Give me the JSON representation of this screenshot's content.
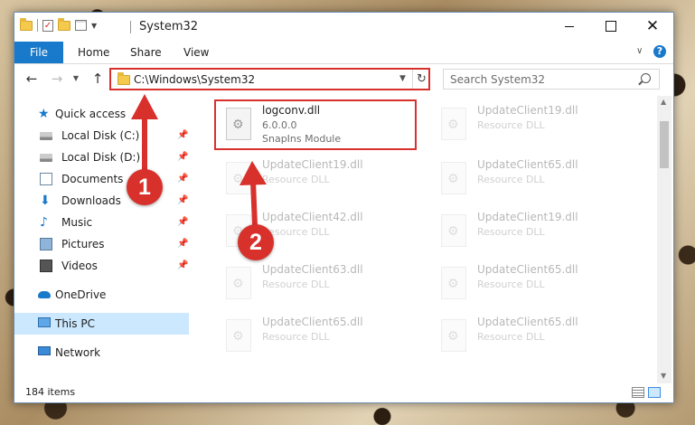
{
  "window": {
    "title": "System32",
    "controls": {
      "minimize": "minimize",
      "maximize": "maximize",
      "close": "✕"
    }
  },
  "ribbon": {
    "tabs": [
      "File",
      "Home",
      "Share",
      "View"
    ]
  },
  "address_bar": {
    "path": "C:\\Windows\\System32",
    "search_placeholder": "Search System32"
  },
  "nav_pane": {
    "items": [
      {
        "label": "Quick access",
        "icon": "star-icon",
        "pinned": false
      },
      {
        "label": "Local Disk (C:)",
        "icon": "disk-icon",
        "pinned": true
      },
      {
        "label": "Local Disk (D:)",
        "icon": "disk-icon",
        "pinned": true
      },
      {
        "label": "Documents",
        "icon": "documents-icon",
        "pinned": true
      },
      {
        "label": "Downloads",
        "icon": "download-icon",
        "pinned": true
      },
      {
        "label": "Music",
        "icon": "music-icon",
        "pinned": true
      },
      {
        "label": "Pictures",
        "icon": "pictures-icon",
        "pinned": true
      },
      {
        "label": "Videos",
        "icon": "videos-icon",
        "pinned": true
      },
      {
        "label": "OneDrive",
        "icon": "cloud-icon",
        "pinned": false
      },
      {
        "label": "This PC",
        "icon": "computer-icon",
        "pinned": false,
        "selected": true
      },
      {
        "label": "Network",
        "icon": "network-icon",
        "pinned": false
      }
    ]
  },
  "files": [
    {
      "name": "logconv.dll",
      "line2": "6.0.0.0",
      "line3": "SnapIns Module",
      "highlighted": true
    },
    {
      "name": "UpdateClient19.dll",
      "line2": "Resource DLL"
    },
    {
      "name": "UpdateClient19.dll",
      "line2": "Resource DLL"
    },
    {
      "name": "UpdateClient65.dll",
      "line2": "Resource DLL"
    },
    {
      "name": "UpdateClient42.dll",
      "line2": "Resource DLL"
    },
    {
      "name": "UpdateClient19.dll",
      "line2": "Resource DLL"
    },
    {
      "name": "UpdateClient63.dll",
      "line2": "Resource DLL"
    },
    {
      "name": "UpdateClient65.dll",
      "line2": "Resource DLL"
    },
    {
      "name": "UpdateClient65.dll",
      "line2": "Resource DLL"
    },
    {
      "name": "UpdateClient65.dll",
      "line2": "Resource DLL"
    }
  ],
  "status_bar": {
    "item_count": "184 items"
  },
  "annotations": {
    "step1": "1",
    "step2": "2",
    "color": "#d8302b"
  }
}
